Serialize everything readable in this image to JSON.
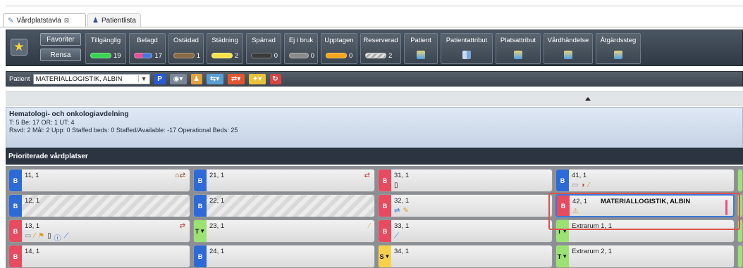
{
  "tabs": [
    {
      "label": "Vårdplatstavla",
      "close": "⊠",
      "active": true
    },
    {
      "label": "Patientlista",
      "active": false
    }
  ],
  "toolbar": {
    "favorites_label": "Favoriter",
    "clear_label": "Rensa",
    "filters": [
      {
        "label": "Tillgänglig",
        "count": "19",
        "color": "#39d353"
      },
      {
        "label": "Belagd",
        "count": "17",
        "color": "#e4508f"
      },
      {
        "label": "Ostädad",
        "count": "1",
        "color": "#8a6a45"
      },
      {
        "label": "Städning",
        "count": "2",
        "color": "#f3e34a"
      },
      {
        "label": "Spärrad",
        "count": "0",
        "color": "#3a3a3a"
      },
      {
        "label": "Ej i bruk",
        "count": "0",
        "color": "#8a8a8a"
      },
      {
        "label": "Upptagen",
        "count": "0",
        "color": "#f3a51c"
      },
      {
        "label": "Reserverad",
        "count": "2",
        "color": "#cfcfcf"
      },
      {
        "label": "Patient",
        "icon": "patient-icon"
      },
      {
        "label": "Patientattribut",
        "icon": "attribute-icon"
      },
      {
        "label": "Platsattribut",
        "icon": "place-attribute-icon"
      },
      {
        "label": "Vårdhändelse",
        "icon": "care-event-icon"
      },
      {
        "label": "Åtgärdssteg",
        "icon": "action-step-icon"
      }
    ]
  },
  "patient_bar": {
    "label": "Patient",
    "selected_patient": "MATERIALLOGISTIK, ALBIN",
    "p_button": "P"
  },
  "department": {
    "name": "Hematologi- och onkologiavdelning",
    "line1": "T: 5 Be: 17 OR: 1 UT: 4",
    "line2": "Rsvd: 2 Mål: 2 Upp: 0 Staffed beds: 0 Staffed/Available: -17 Operational Beds: 25"
  },
  "prioritized_header": "Prioriterade vårdplatser",
  "beds": [
    {
      "num": "11, 1",
      "status": "B"
    },
    {
      "num": "21, 1",
      "status": "B"
    },
    {
      "num": "31, 1",
      "status": "B"
    },
    {
      "num": "41, 1",
      "status": "B"
    },
    {
      "num": "12, 1",
      "status": "B"
    },
    {
      "num": "22, 1",
      "status": "B"
    },
    {
      "num": "32, 1",
      "status": "B"
    },
    {
      "num": "42, 1",
      "status": "B",
      "patient": "MATERIALLOGISTIK, ALBIN"
    },
    {
      "num": "13, 1",
      "status": "B"
    },
    {
      "num": "23, 1",
      "status": "T"
    },
    {
      "num": "33, 1",
      "status": "B"
    },
    {
      "num": "Extrarum 1, 1",
      "status": "T"
    },
    {
      "num": "14, 1",
      "status": "B"
    },
    {
      "num": "24, 1",
      "status": "B"
    },
    {
      "num": "34, 1",
      "status": "S"
    },
    {
      "num": "Extrarum 2, 1",
      "status": "T"
    }
  ],
  "colors": {
    "status_B": "#2d6ad8",
    "status_B_red": "#e84a5f",
    "status_T": "#9be272",
    "status_S": "#f6d24a",
    "highlight": "#d9534f"
  }
}
